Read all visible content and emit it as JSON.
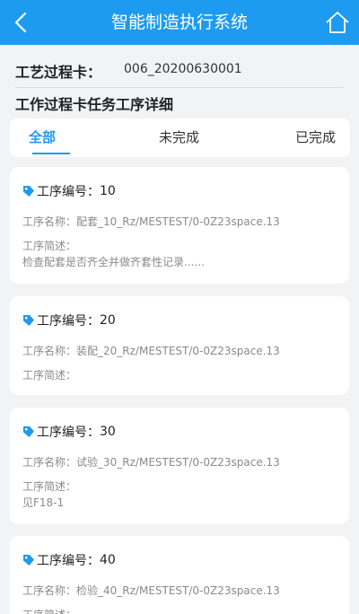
{
  "header": {
    "title": "智能制造执行系统",
    "back_icon": "chevron-left-icon",
    "home_icon": "home-icon",
    "bg_color": "#1d9bf0"
  },
  "info": {
    "card_label": "工艺过程卡：",
    "card_value": "006_20200630001",
    "section_title": "工作过程卡任务工序详细"
  },
  "tabs": [
    {
      "label": "全部",
      "active": true
    },
    {
      "label": "未完成",
      "active": false
    },
    {
      "label": "已完成",
      "active": false
    }
  ],
  "procedures": [
    {
      "number_label": "工序编号：",
      "number": "10",
      "name_label": "工序名称：",
      "name": "配套_10_Rz/MESTEST/0-0Z23space.13",
      "desc_label": "工序简述：",
      "desc": "检查配套是否齐全并做齐套性记录......"
    },
    {
      "number_label": "工序编号：",
      "number": "20",
      "name_label": "工序名称：",
      "name": "装配_20_Rz/MESTEST/0-0Z23space.13",
      "desc_label": "工序简述：",
      "desc": ""
    },
    {
      "number_label": "工序编号：",
      "number": "30",
      "name_label": "工序名称：",
      "name": "试验_30_Rz/MESTEST/0-0Z23space.13",
      "desc_label": "工序简述：",
      "desc": "见F18-1"
    },
    {
      "number_label": "工序编号：",
      "number": "40",
      "name_label": "工序名称：",
      "name": "检验_40_Rz/MESTEST/0-0Z23space.13",
      "desc_label": "工序简述：",
      "desc": ""
    }
  ],
  "accent_color": "#1d9bf0",
  "tag_icon": "tag-icon"
}
